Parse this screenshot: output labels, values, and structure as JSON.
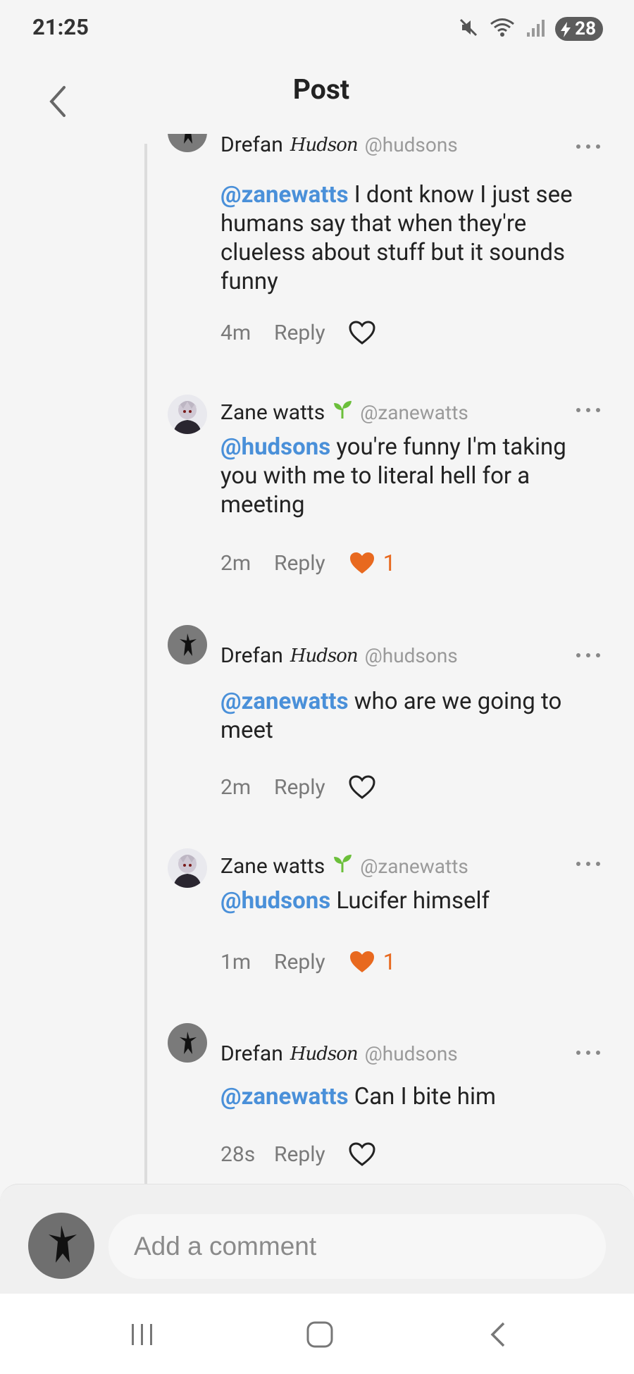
{
  "status_bar": {
    "time": "21:25",
    "battery": "28"
  },
  "header": {
    "title": "Post"
  },
  "comments": [
    {
      "name": "Drefan",
      "name_deco": "Hudson",
      "handle": "@hudsons",
      "mention": "@zanewatts",
      "text": " I dont know I just see humans say that when they're clueless about stuff but it sounds funny",
      "time": "4m",
      "reply_label": "Reply",
      "liked": false,
      "likes": ""
    },
    {
      "name": "Zane watts",
      "badge": "sprout-icon",
      "handle": "@zanewatts",
      "mention": "@hudsons",
      "text": " you're funny I'm taking you with me to literal hell for a meeting",
      "time": "2m",
      "reply_label": "Reply",
      "liked": true,
      "likes": "1"
    },
    {
      "name": "Drefan",
      "name_deco": "Hudson",
      "handle": "@hudsons",
      "mention": "@zanewatts",
      "text": " who are we going to meet",
      "time": "2m",
      "reply_label": "Reply",
      "liked": false,
      "likes": ""
    },
    {
      "name": "Zane watts",
      "badge": "sprout-icon",
      "handle": "@zanewatts",
      "mention": "@hudsons",
      "text": " Lucifer himself",
      "time": "1m",
      "reply_label": "Reply",
      "liked": true,
      "likes": "1"
    },
    {
      "name": "Drefan",
      "name_deco": "Hudson",
      "handle": "@hudsons",
      "mention": "@zanewatts",
      "text": " Can I bite him",
      "time": "28s",
      "reply_label": "Reply",
      "liked": false,
      "likes": ""
    }
  ],
  "composer": {
    "placeholder": "Add a comment"
  },
  "colors": {
    "mention": "#4a90d9",
    "like": "#e8691f",
    "sprout": "#6bbf3a"
  }
}
